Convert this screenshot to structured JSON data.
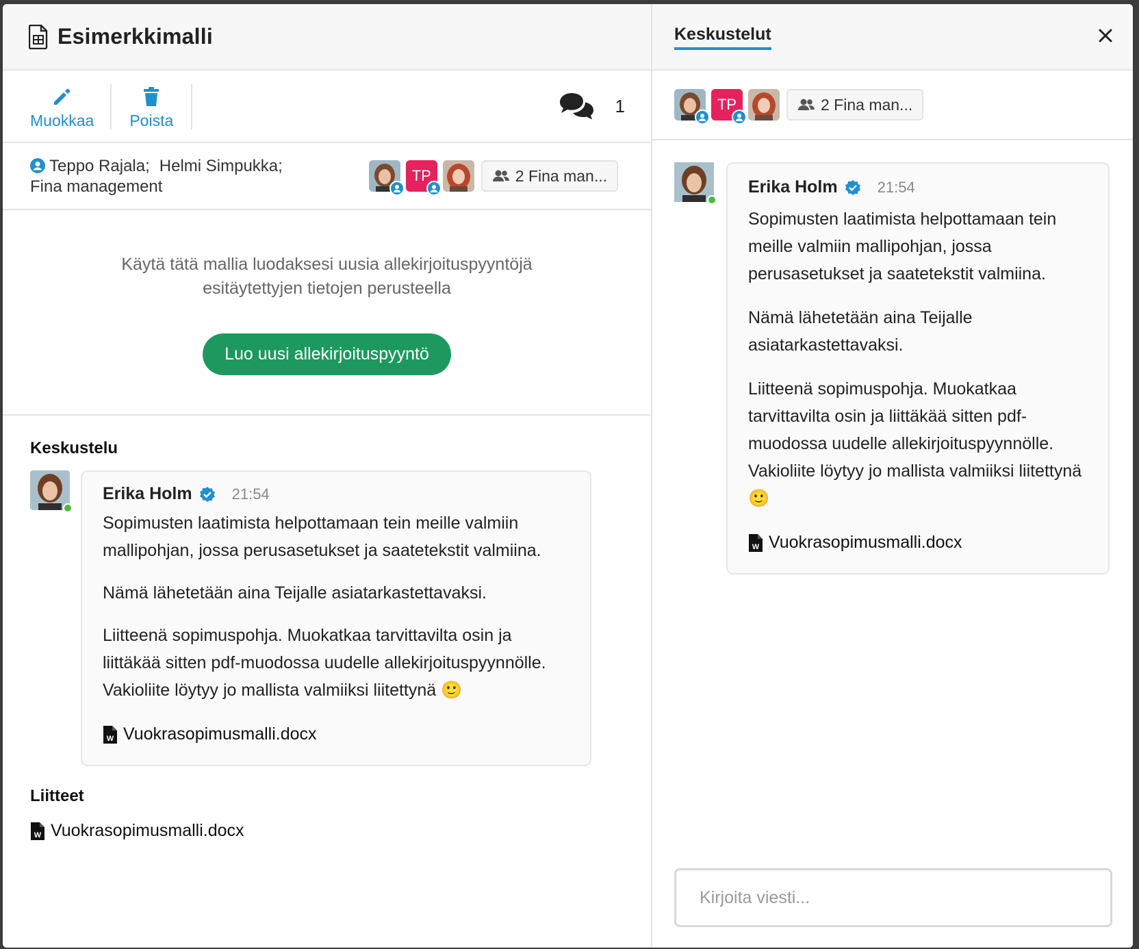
{
  "template": {
    "title": "Esimerkkimalli",
    "toolbar": {
      "edit_label": "Muokkaa",
      "delete_label": "Poista",
      "comment_count": "1"
    },
    "participants": {
      "names": [
        "Teppo Rajala;",
        "Helmi Simpukka;",
        "Fina management"
      ],
      "avatar_initials": "TP",
      "group_label": "2 Fina man..."
    },
    "intro": {
      "line1": "Käytä tätä mallia luodaksesi uusia allekirjoituspyyntöjä",
      "line2": "esitäytettyjen tietojen perusteella",
      "create_button": "Luo uusi allekirjoituspyyntö"
    },
    "conversation_title": "Keskustelu",
    "attachments_title": "Liitteet",
    "attachment_file": "Vuokrasopimusmalli.docx"
  },
  "message": {
    "author": "Erika Holm",
    "time": "21:54",
    "paragraphs": [
      "Sopimusten laatimista helpottamaan tein meille valmiin mallipohjan, jossa perusasetukset ja saatetekstit valmiina.",
      "Nämä lähetetään aina Teijalle asiatarkastettavaksi.",
      "Liitteenä sopimuspohja. Muokatkaa tarvittavilta osin ja liittäkää sitten pdf-muodossa uudelle allekirjoituspyynnölle. Vakioliite löytyy jo mallista valmiiksi liitettynä 🙂"
    ],
    "attachment": "Vuokrasopimusmalli.docx"
  },
  "chat_panel": {
    "tab_label": "Keskustelut",
    "avatar_initials": "TP",
    "group_label": "2 Fina man...",
    "composer_placeholder": "Kirjoita viesti..."
  },
  "colors": {
    "accent": "#1f8fd0",
    "primary_button": "#1d9960",
    "avatar_tp": "#e5225e",
    "online": "#4cbb3c"
  }
}
